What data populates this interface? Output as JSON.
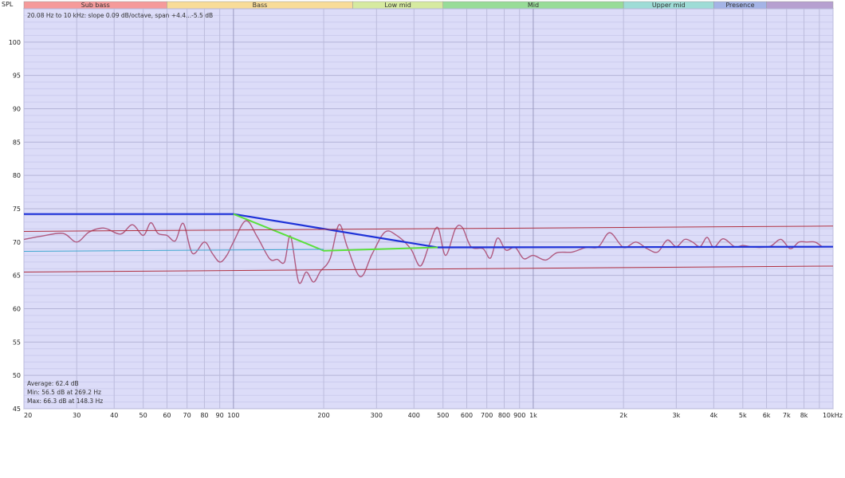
{
  "chart_data": {
    "type": "line",
    "y_axis_label": "SPL",
    "x_scale": "log",
    "xlim": [
      20,
      10000
    ],
    "ylim": [
      45,
      105
    ],
    "y_ticks": [
      45,
      50,
      55,
      60,
      65,
      70,
      75,
      80,
      85,
      90,
      95,
      100
    ],
    "x_ticks": [
      {
        "value": 20,
        "label": "20"
      },
      {
        "value": 30,
        "label": "30"
      },
      {
        "value": 40,
        "label": "40"
      },
      {
        "value": 50,
        "label": "50"
      },
      {
        "value": 60,
        "label": "60"
      },
      {
        "value": 70,
        "label": "70"
      },
      {
        "value": 80,
        "label": "80"
      },
      {
        "value": 90,
        "label": "90"
      },
      {
        "value": 100,
        "label": "100"
      },
      {
        "value": 200,
        "label": "200"
      },
      {
        "value": 300,
        "label": "300"
      },
      {
        "value": 400,
        "label": "400"
      },
      {
        "value": 500,
        "label": "500"
      },
      {
        "value": 600,
        "label": "600"
      },
      {
        "value": 700,
        "label": "700"
      },
      {
        "value": 800,
        "label": "800"
      },
      {
        "value": 900,
        "label": "900"
      },
      {
        "value": 1000,
        "label": "1k"
      },
      {
        "value": 2000,
        "label": "2k"
      },
      {
        "value": 3000,
        "label": "3k"
      },
      {
        "value": 4000,
        "label": "4k"
      },
      {
        "value": 5000,
        "label": "5k"
      },
      {
        "value": 6000,
        "label": "6k"
      },
      {
        "value": 7000,
        "label": "7k"
      },
      {
        "value": 8000,
        "label": "8k"
      },
      {
        "value": 10000,
        "label": "10kHz"
      }
    ],
    "bands": [
      {
        "label": "Sub bass",
        "from": 20,
        "to": 60,
        "color": "#f59a9a"
      },
      {
        "label": "Bass",
        "from": 60,
        "to": 250,
        "color": "#f8dc98"
      },
      {
        "label": "Low mid",
        "from": 250,
        "to": 500,
        "color": "#d6eaa0"
      },
      {
        "label": "Mid",
        "from": 500,
        "to": 2000,
        "color": "#98dc98"
      },
      {
        "label": "Upper mid",
        "from": 2000,
        "to": 4000,
        "color": "#9edcd6"
      },
      {
        "label": "Presence",
        "from": 4000,
        "to": 6000,
        "color": "#a4b4e6"
      },
      {
        "label": "",
        "from": 6000,
        "to": 10000,
        "color": "#b6a0d0"
      }
    ],
    "annotation": "20.08 Hz to 10 kHz: slope 0.09 dB/octave, span +4.4...-5.5 dB",
    "stats": [
      "Average: 62.4 dB",
      "Min: 56.5 dB at 269.2 Hz",
      "Max: 66.3 dB at 148.3 Hz"
    ],
    "series": [
      {
        "color": "#b05a80",
        "x": [
          20,
          23,
          27,
          30,
          33,
          37,
          42,
          46,
          50,
          53,
          56,
          60,
          64,
          68,
          73,
          80,
          85,
          90,
          95,
          100,
          110,
          120,
          132,
          140,
          148,
          155,
          165,
          175,
          185,
          195,
          210,
          225,
          240,
          265,
          290,
          320,
          350,
          390,
          420,
          450,
          480,
          510,
          550,
          580,
          620,
          680,
          720,
          760,
          810,
          870,
          930,
          1000,
          1100,
          1200,
          1350,
          1500,
          1650,
          1800,
          2000,
          2200,
          2400,
          2600,
          2800,
          3000,
          3200,
          3400,
          3600,
          3800,
          4000,
          4300,
          4700,
          5000,
          5300,
          5700,
          6200,
          6700,
          7200,
          7700,
          8200,
          8700,
          9200
        ],
        "y": [
          70.4,
          70.9,
          71.3,
          70.0,
          71.5,
          72.1,
          71.2,
          72.6,
          71.0,
          72.9,
          71.3,
          71.0,
          70.2,
          72.8,
          68.3,
          70.0,
          68.3,
          67.0,
          68.0,
          70.0,
          73.2,
          70.8,
          67.5,
          67.4,
          67.0,
          70.9,
          64.0,
          65.5,
          64.0,
          65.6,
          67.5,
          72.6,
          69.2,
          64.8,
          68.2,
          71.5,
          71.0,
          69.0,
          66.4,
          69.6,
          72.2,
          68.0,
          72.0,
          72.2,
          69.3,
          69.0,
          67.6,
          70.6,
          68.8,
          69.2,
          67.5,
          68.0,
          67.3,
          68.4,
          68.5,
          69.2,
          69.3,
          71.4,
          69.2,
          70.0,
          69.0,
          68.5,
          70.3,
          69.3,
          70.4,
          70.0,
          69.3,
          70.7,
          69.2,
          70.5,
          69.3,
          69.5,
          69.3,
          69.2,
          69.4,
          70.4,
          69.0,
          70.0,
          70.0,
          70.0,
          69.3
        ]
      },
      {
        "color": "#1e32d8",
        "x": [
          20,
          100,
          480,
          10000
        ],
        "y": [
          74.2,
          74.2,
          69.2,
          69.3
        ]
      },
      {
        "color": "#5ae03c",
        "x": [
          100,
          160,
          200,
          480
        ],
        "y": [
          74.2,
          70.5,
          68.7,
          69.2
        ]
      },
      {
        "color": "#b03040",
        "x": [
          20,
          10000
        ],
        "y": [
          71.6,
          72.4
        ]
      },
      {
        "color": "#b03040",
        "x": [
          20,
          10000
        ],
        "y": [
          65.5,
          66.4
        ]
      },
      {
        "color": "#40a8d0",
        "x": [
          20,
          200
        ],
        "y": [
          68.6,
          68.9
        ]
      }
    ]
  }
}
